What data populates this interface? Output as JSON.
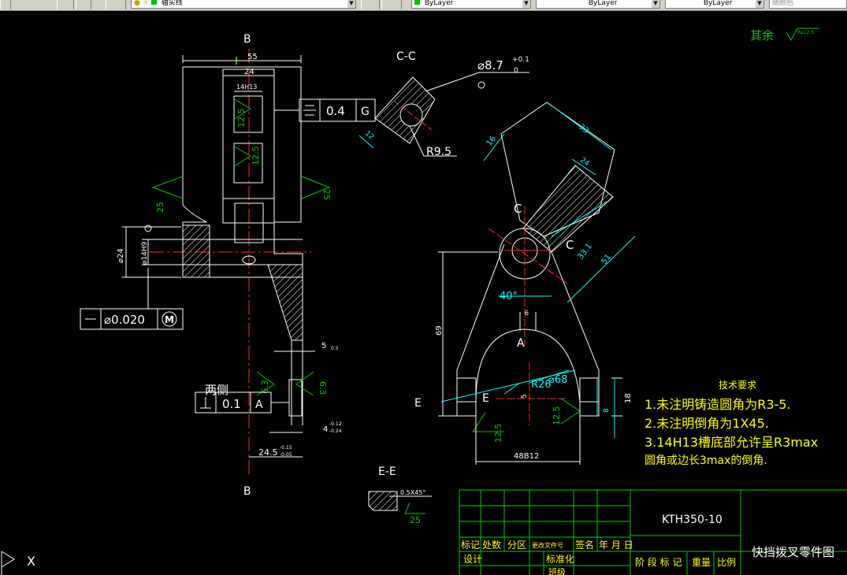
{
  "toolbar": {
    "layer_name": "轴实线",
    "color_name": "ByLayer",
    "linetype_name": "ByLayer",
    "lineweight_name": "ByLayer",
    "plotstyle_name": "随颜色"
  },
  "colors": {
    "background": "#000000",
    "outline": "#ffffff",
    "center": "#ff2a2a",
    "dimension": "#00ffff",
    "finish": "#00c800",
    "notes": "#ffff00"
  },
  "drawing": {
    "finish_note_label": "其余",
    "finish_note_value": "Ra12.5",
    "section_b_top": "B",
    "section_b_bottom": "B",
    "dim_55": "55",
    "dim_24": "24",
    "dim_14h13": "14H13",
    "rough_125a": "12.5",
    "rough_125b": "12.5",
    "rough_25_left": "25",
    "rough_25_right": "25",
    "tol_symmetry_value": "0.4",
    "tol_symmetry_datum": "G",
    "dim_phi24": "⌀24",
    "dim_phi14h9": "⌀14H9",
    "tol_flat_value": "⌀0.020",
    "tol_flat_modifier": "M",
    "dim_5": "5",
    "dim_5_tol": "0.5",
    "rough_63a": "6.3",
    "rough_63b": "6.3",
    "liangce_label": "两侧",
    "tol_perp_value": "0.1",
    "tol_perp_datum": "A",
    "dim_4": "4",
    "dim_4_upper": "-0.12",
    "dim_4_lower": "-0.24",
    "dim_245": "24.5",
    "dim_245_upper": "-0.15",
    "dim_245_lower": "-0.05",
    "section_cc_title": "C-C",
    "hole_phi87": "⌀8.7",
    "hole_phi87_upper": "+0.1",
    "hole_phi87_lower": "0",
    "dim_12": "12",
    "dim_r95": "R9.5",
    "dim_33": "33",
    "dim_16": "16",
    "dim_24b": "24",
    "section_c1": "C",
    "section_c2": "C",
    "dim_331": "33.1",
    "dim_51": "51",
    "dim_69": "69",
    "dim_40deg": "40°",
    "dim_6": "6",
    "section_a": "A",
    "dim_r26": "R26",
    "dim_phi68": "⌀68",
    "dim_5b": "5",
    "section_e1": "E",
    "section_e2": "E",
    "rough_125c": "12.5",
    "rough_125d": "12.5",
    "dim_8": "8",
    "dim_18": "18",
    "dim_48b12": "48B12",
    "section_ee_title": "E-E",
    "ee_chamfer": "0.5X45°",
    "rough_25_ee": "25",
    "tech_title": "技术要求",
    "tech_line1": "1.未注明铸造圆角为R3-5.",
    "tech_line2": "2.未注明倒角为1X45.",
    "tech_line3": "3.14H13槽底部允许呈R3max",
    "tech_line4": "圆角或边长3max的倒角."
  },
  "title_block": {
    "part_code": "KTH350-10",
    "part_name": "快挡拨叉零件图",
    "row_labels": [
      "标记",
      "处数",
      "分区",
      "更改文件号",
      "签名",
      "年 月 日"
    ],
    "design_label": "设计",
    "standard_label": "标准化",
    "stage_label": "阶 段 标 记",
    "weight_label": "重量",
    "scale_label": "比例",
    "partial_label": "班级"
  },
  "ucs": {
    "x_label": "X"
  }
}
